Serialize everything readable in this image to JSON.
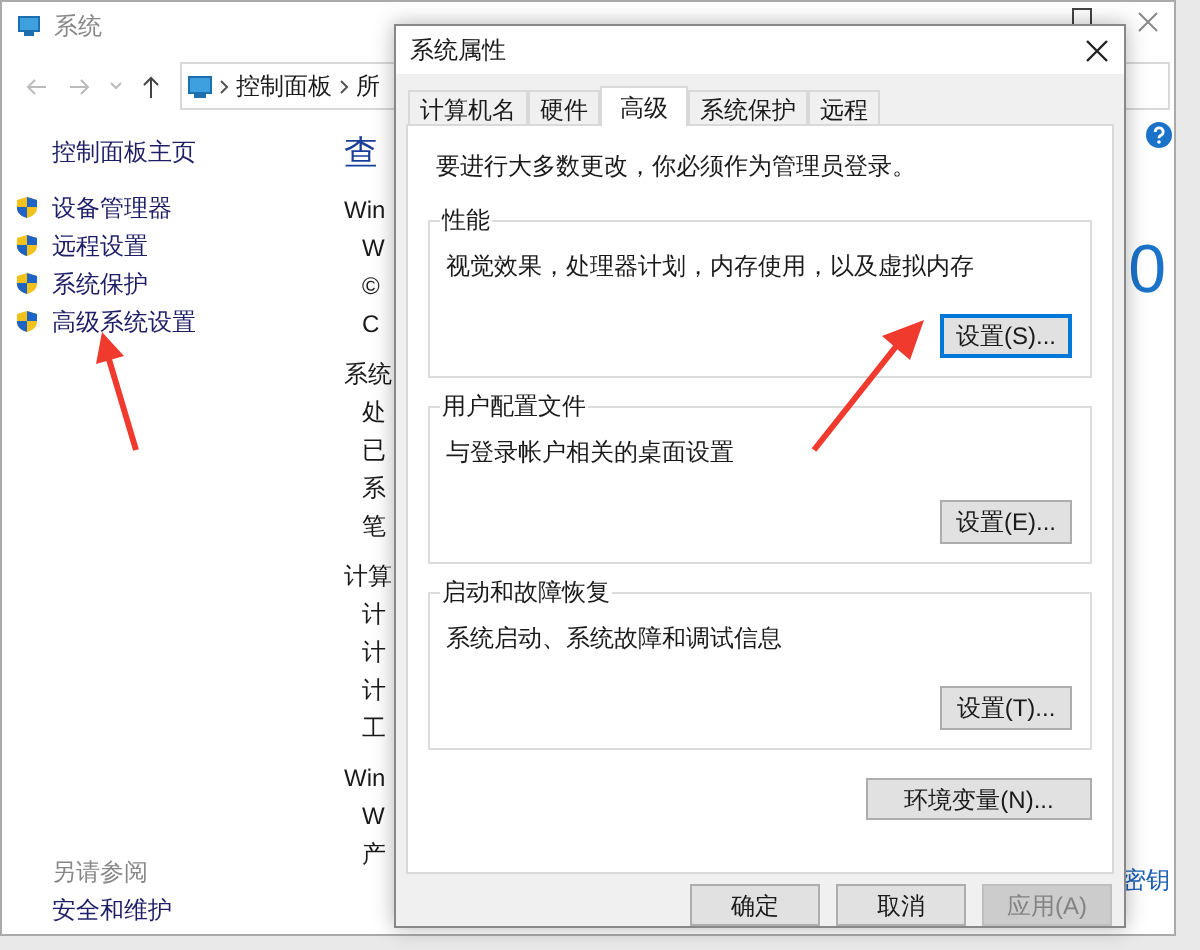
{
  "window": {
    "title": "系统"
  },
  "nav": {
    "breadcrumbs": [
      "控制面板",
      "所"
    ]
  },
  "sidebar": {
    "home": "控制面板主页",
    "links": [
      "设备管理器",
      "远程设置",
      "系统保护",
      "高级系统设置"
    ],
    "see_also": {
      "heading": "另请参阅",
      "links": [
        "安全和维护"
      ]
    }
  },
  "main": {
    "lines": [
      {
        "text": "查",
        "kind": "title"
      },
      {
        "text": "Win",
        "kind": "section"
      },
      {
        "text": "W",
        "kind": "item"
      },
      {
        "text": "©",
        "kind": "item"
      },
      {
        "text": "C",
        "kind": "item"
      },
      {
        "text": "系统",
        "kind": "section"
      },
      {
        "text": "处",
        "kind": "item"
      },
      {
        "text": "已",
        "kind": "item"
      },
      {
        "text": "系",
        "kind": "item"
      },
      {
        "text": "笔",
        "kind": "item"
      },
      {
        "text": "计算",
        "kind": "section"
      },
      {
        "text": "计",
        "kind": "item"
      },
      {
        "text": "计",
        "kind": "item"
      },
      {
        "text": "计",
        "kind": "item"
      },
      {
        "text": "工",
        "kind": "item"
      },
      {
        "text": "Win",
        "kind": "section"
      },
      {
        "text": "W",
        "kind": "item"
      },
      {
        "text": "产",
        "kind": "item"
      }
    ]
  },
  "right_edge": {
    "big_digit": "0",
    "link": "密钥"
  },
  "dialog": {
    "title": "系统属性",
    "tabs": [
      {
        "label": "计算机名",
        "selected": false
      },
      {
        "label": "硬件",
        "selected": false
      },
      {
        "label": "高级",
        "selected": true
      },
      {
        "label": "系统保护",
        "selected": false
      },
      {
        "label": "远程",
        "selected": false
      }
    ],
    "notice": "要进行大多数更改，你必须作为管理员登录。",
    "groups": [
      {
        "title": "性能",
        "description": "视觉效果，处理器计划，内存使用，以及虚拟内存",
        "button": "设置(S)...",
        "focused": true
      },
      {
        "title": "用户配置文件",
        "description": "与登录帐户相关的桌面设置",
        "button": "设置(E)...",
        "focused": false
      },
      {
        "title": "启动和故障恢复",
        "description": "系统启动、系统故障和调试信息",
        "button": "设置(T)...",
        "focused": false
      }
    ],
    "env_button": "环境变量(N)...",
    "buttons": [
      {
        "label": "确定",
        "disabled": false
      },
      {
        "label": "取消",
        "disabled": false
      },
      {
        "label": "应用(A)",
        "disabled": true
      }
    ]
  }
}
